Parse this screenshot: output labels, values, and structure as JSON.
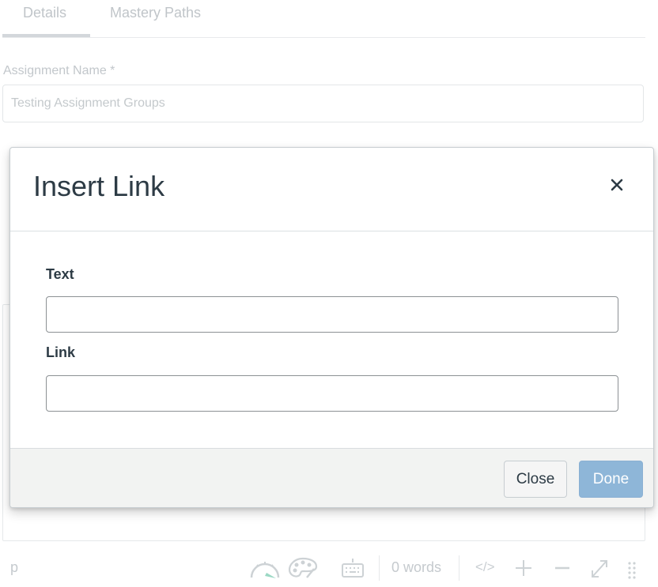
{
  "tabs": [
    {
      "label": "Details",
      "active": true
    },
    {
      "label": "Mastery Paths",
      "active": false
    }
  ],
  "form": {
    "name_label": "Assignment Name *",
    "name_value": "Testing Assignment Groups"
  },
  "statusbar": {
    "element_path": "p",
    "word_count": "0 words",
    "html_toggle": "</>"
  },
  "dialog": {
    "title": "Insert Link",
    "close_glyph": "×",
    "text_label": "Text",
    "text_value": "",
    "link_label": "Link",
    "link_value": "",
    "close_button": "Close",
    "done_button": "Done"
  },
  "colors": {
    "done_bg": "#8eb6d8",
    "title_text": "#2d3b45",
    "footer_bg": "#f2f3f2"
  }
}
